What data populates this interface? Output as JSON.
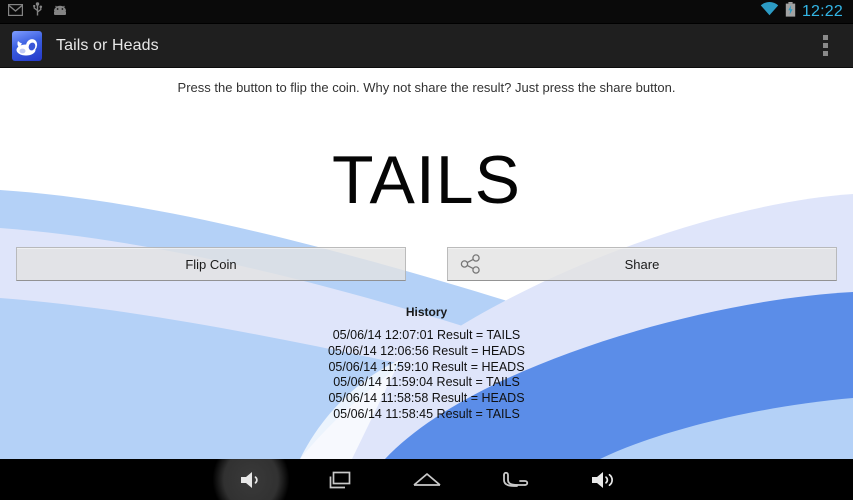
{
  "status_bar": {
    "icons": [
      "mail-icon",
      "usb-icon",
      "android-icon"
    ],
    "right_icons": [
      "wifi-icon",
      "battery-charging-icon"
    ],
    "clock": "12:22",
    "clock_color": "#33b5e5"
  },
  "action_bar": {
    "app_icon": "coin-app-icon",
    "title": "Tails or Heads",
    "overflow": "overflow-menu-icon"
  },
  "main": {
    "instruction": "Press the button to flip the coin. Why not share the result? Just press the share button.",
    "result": "TAILS",
    "flip_button": {
      "label": "Flip Coin"
    },
    "share_button": {
      "label": "Share",
      "icon": "share-icon"
    },
    "history": {
      "title": "History",
      "entries": [
        "05/06/14 12:07:01 Result = TAILS",
        "05/06/14 12:06:56 Result = HEADS",
        "05/06/14 11:59:10 Result = HEADS",
        "05/06/14 11:59:04 Result = TAILS",
        "05/06/14 11:58:58 Result = HEADS",
        "05/06/14 11:58:45 Result = TAILS"
      ]
    }
  },
  "nav_bar": {
    "buttons": [
      {
        "name": "volume-down-button",
        "icon": "volume-down-icon",
        "pressed": true
      },
      {
        "name": "recents-button",
        "icon": "recents-icon",
        "pressed": false
      },
      {
        "name": "home-button",
        "icon": "home-icon",
        "pressed": false
      },
      {
        "name": "back-button",
        "icon": "back-icon",
        "pressed": false
      },
      {
        "name": "volume-up-button",
        "icon": "volume-up-icon",
        "pressed": false
      }
    ]
  },
  "theme": {
    "accent": "#33b5e5",
    "action_bar_bg": "#1f1f1f",
    "content_bg": "#ffffff",
    "wallpaper_blue_dark": "#5b8de8",
    "wallpaper_blue_light": "#b4d1f7",
    "wallpaper_pale": "#dfe5fa"
  }
}
